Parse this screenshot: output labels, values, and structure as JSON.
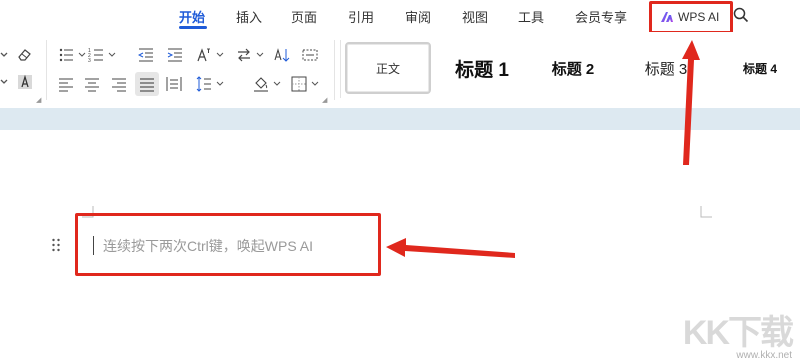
{
  "menubar": {
    "tabs": [
      {
        "label": "开始",
        "active": true
      },
      {
        "label": "插入"
      },
      {
        "label": "页面"
      },
      {
        "label": "引用"
      },
      {
        "label": "审阅"
      },
      {
        "label": "视图"
      },
      {
        "label": "工具"
      },
      {
        "label": "会员专享"
      }
    ],
    "wps_ai": {
      "label": "WPS AI",
      "icon": "wps-ai-logo-icon"
    },
    "search_icon": "search-icon"
  },
  "styles": [
    {
      "label": "正文",
      "selected": true
    },
    {
      "label": "标题 1"
    },
    {
      "label": "标题 2"
    },
    {
      "label": "标题 3"
    },
    {
      "label": "标题 4"
    }
  ],
  "editor": {
    "placeholder": "连续按下两次Ctrl键，唤起WPS AI"
  },
  "watermark": {
    "logo": "KK下载",
    "url": "www.kkx.net"
  },
  "colors": {
    "accent": "#1f5bd8",
    "highlight": "#e0281d",
    "band": "#dde9f1"
  }
}
